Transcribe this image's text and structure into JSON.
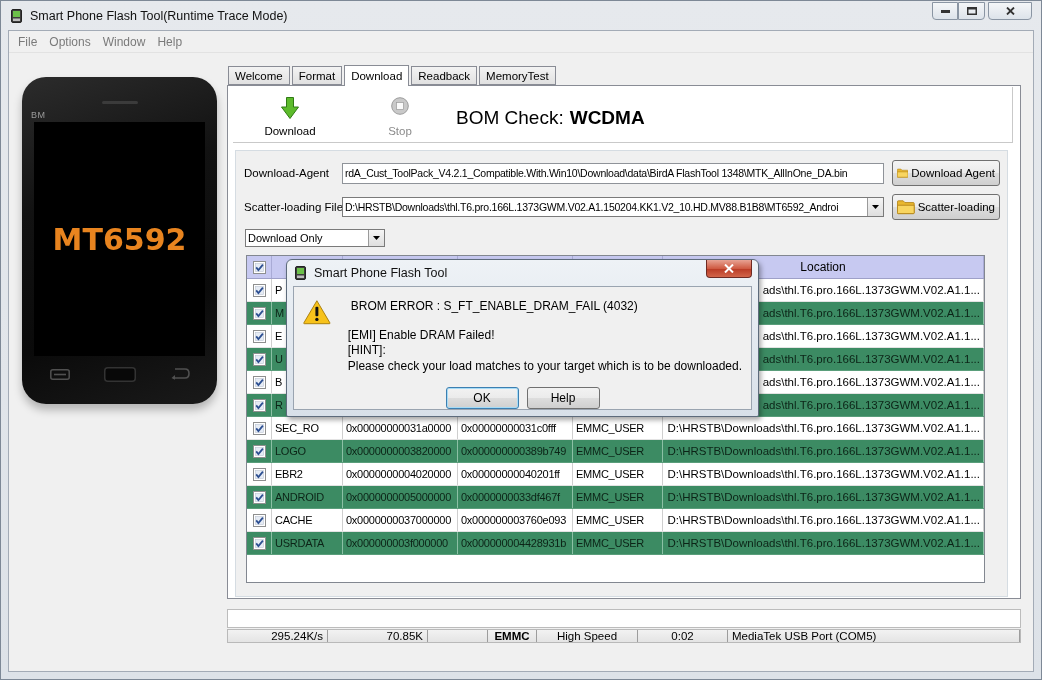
{
  "window": {
    "title": "Smart Phone Flash Tool(Runtime Trace Mode)"
  },
  "menu": [
    {
      "label": "File",
      "disabled": true
    },
    {
      "label": "Options",
      "disabled": true
    },
    {
      "label": "Window",
      "disabled": true
    },
    {
      "label": "Help",
      "disabled": true
    }
  ],
  "phone": {
    "brand": "BM",
    "model": "MT6592"
  },
  "tabs": [
    {
      "label": "Welcome",
      "selected": false
    },
    {
      "label": "Format",
      "selected": false
    },
    {
      "label": "Download",
      "selected": true
    },
    {
      "label": "Readback",
      "selected": false
    },
    {
      "label": "MemoryTest",
      "selected": false
    }
  ],
  "toolbar": {
    "buttons": [
      {
        "kind": "download",
        "label": "Download",
        "disabled": false
      },
      {
        "kind": "stop",
        "label": "Stop",
        "disabled": true
      }
    ],
    "bom_check": {
      "label": "BOM Check:",
      "value": "WCDMA"
    }
  },
  "download_agent": {
    "label": "Download-Agent",
    "value": "rdA_Cust_ToolPack_V4.2.1_Compatible.With.Win10\\Download\\data\\BirdA FlashTool 1348\\MTK_AllInOne_DA.bin",
    "button": "Download Agent"
  },
  "scatter_file": {
    "label": "Scatter-loading File",
    "value": "D:\\HRSTB\\Downloads\\thl.T6.pro.166L.1373GWM.V02.A1.150204.KK1.V2_10.HD.MV88.B1B8\\MT6592_Androi",
    "button": "Scatter-loading"
  },
  "mode": {
    "value": "Download Only"
  },
  "table": {
    "header": {
      "checked": true,
      "location": "Location"
    },
    "rows": [
      {
        "checked": true,
        "name": "P",
        "location": "ads\\thl.T6.pro.166L.1373GWM.V02.A1.1..."
      },
      {
        "checked": true,
        "name": "M",
        "location": "ads\\thl.T6.pro.166L.1373GWM.V02.A1.1..."
      },
      {
        "checked": true,
        "name": "E",
        "location": "ads\\thl.T6.pro.166L.1373GWM.V02.A1.1..."
      },
      {
        "checked": true,
        "name": "U",
        "location": "ads\\thl.T6.pro.166L.1373GWM.V02.A1.1..."
      },
      {
        "checked": true,
        "name": "B",
        "location": "ads\\thl.T6.pro.166L.1373GWM.V02.A1.1..."
      },
      {
        "checked": true,
        "name": "R",
        "location": "ads\\thl.T6.pro.166L.1373GWM.V02.A1.1..."
      },
      {
        "checked": true,
        "name": "SEC_RO",
        "begin": "0x00000000031a0000",
        "end": "0x00000000031c0fff",
        "region": "EMMC_USER",
        "location": "D:\\HRSTB\\Downloads\\thl.T6.pro.166L.1373GWM.V02.A1.1..."
      },
      {
        "checked": true,
        "name": "LOGO",
        "begin": "0x0000000003820000",
        "end": "0x000000000389b749",
        "region": "EMMC_USER",
        "location": "D:\\HRSTB\\Downloads\\thl.T6.pro.166L.1373GWM.V02.A1.1..."
      },
      {
        "checked": true,
        "name": "EBR2",
        "begin": "0x0000000004020000",
        "end": "0x00000000040201ff",
        "region": "EMMC_USER",
        "location": "D:\\HRSTB\\Downloads\\thl.T6.pro.166L.1373GWM.V02.A1.1..."
      },
      {
        "checked": true,
        "name": "ANDROID",
        "begin": "0x0000000005000000",
        "end": "0x0000000033df467f",
        "region": "EMMC_USER",
        "location": "D:\\HRSTB\\Downloads\\thl.T6.pro.166L.1373GWM.V02.A1.1..."
      },
      {
        "checked": true,
        "name": "CACHE",
        "begin": "0x0000000037000000",
        "end": "0x000000003760e093",
        "region": "EMMC_USER",
        "location": "D:\\HRSTB\\Downloads\\thl.T6.pro.166L.1373GWM.V02.A1.1..."
      },
      {
        "checked": true,
        "name": "USRDATA",
        "begin": "0x000000003f000000",
        "end": "0x000000004428931b",
        "region": "EMMC_USER",
        "location": "D:\\HRSTB\\Downloads\\thl.T6.pro.166L.1373GWM.V02.A1.1..."
      }
    ]
  },
  "dialog": {
    "title": "Smart Phone Flash Tool",
    "error": "BROM ERROR : S_FT_ENABLE_DRAM_FAIL (4032)",
    "lines": [
      "[EMI] Enable DRAM Failed!",
      "[HINT]:",
      "Please check your load matches to your target which is to be downloaded."
    ],
    "buttons": [
      {
        "label": "OK",
        "focused": true
      },
      {
        "label": "Help",
        "focused": false
      }
    ]
  },
  "progress": {
    "level": 0
  },
  "status_bar": {
    "speed": "295.24K/s",
    "size": "70.85K",
    "storage": "EMMC",
    "usb_speed": "High Speed",
    "time": "0:02",
    "port": "MediaTek USB Port (COM5)"
  }
}
